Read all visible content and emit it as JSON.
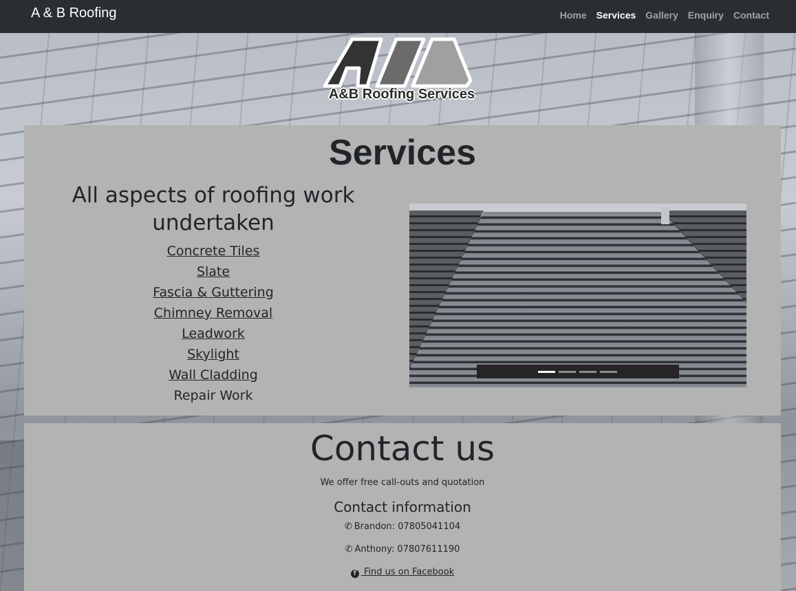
{
  "navbar": {
    "brand": "A & B Roofing",
    "links": [
      "Home",
      "Services",
      "Gallery",
      "Enquiry",
      "Contact"
    ],
    "active": "Services"
  },
  "logo": {
    "text": "A&B Roofing Services",
    "colors": [
      "#333333",
      "#6b6b6b",
      "#a0a0a0"
    ]
  },
  "services": {
    "title": "Services",
    "subtitle": "All aspects of roofing work undertaken",
    "items": [
      {
        "label": "Concrete Tiles",
        "link": true
      },
      {
        "label": "Slate",
        "link": true
      },
      {
        "label": "Fascia & Guttering",
        "link": true
      },
      {
        "label": "Chimney Removal",
        "link": true
      },
      {
        "label": "Leadwork",
        "link": true
      },
      {
        "label": "Skylight",
        "link": true
      },
      {
        "label": "Wall Cladding",
        "link": true
      },
      {
        "label": "Repair Work",
        "link": false
      }
    ],
    "carousel": {
      "slides": 4,
      "active_index": 0
    }
  },
  "contact": {
    "title": "Contact us",
    "tagline": "We offer free call-outs and quotation",
    "info_heading": "Contact information",
    "phones": [
      {
        "icon": "phone-icon",
        "text": "Brandon: 07805041104"
      },
      {
        "icon": "phone-icon",
        "text": "Anthony: 07807611190"
      }
    ],
    "facebook": {
      "icon": "facebook-icon",
      "label": " Find us on Facebook"
    }
  },
  "colors": {
    "navbar_bg": "#2a2e33",
    "panel_bg": "#b3b3b3",
    "text": "#212529"
  }
}
